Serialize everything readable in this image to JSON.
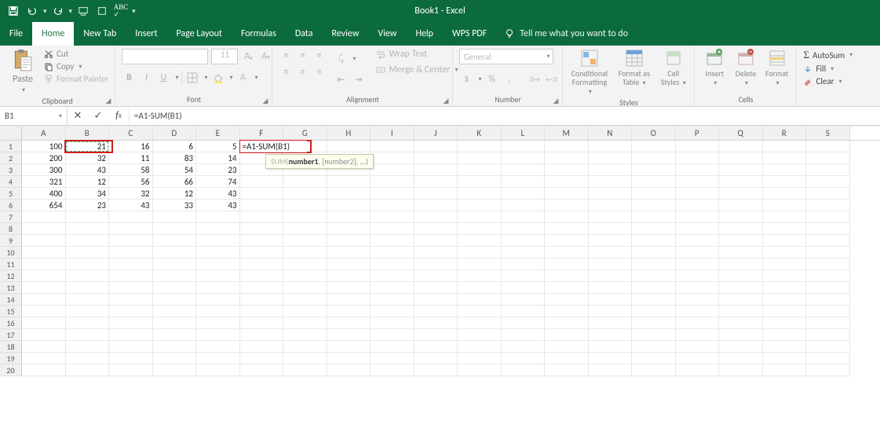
{
  "window": {
    "title": "Book1 - Excel"
  },
  "tabs": [
    "File",
    "Home",
    "New Tab",
    "Insert",
    "Page Layout",
    "Formulas",
    "Data",
    "Review",
    "View",
    "Help",
    "WPS PDF"
  ],
  "active_tab": "Home",
  "tell_me": "Tell me what you want to do",
  "ribbon": {
    "clipboard": {
      "paste": "Paste",
      "cut": "Cut",
      "copy": "Copy",
      "format_painter": "Format Painter",
      "label": "Clipboard"
    },
    "font": {
      "size": "11",
      "label": "Font"
    },
    "alignment": {
      "wrap": "Wrap Text",
      "merge": "Merge & Center",
      "label": "Alignment"
    },
    "number": {
      "format": "General",
      "label": "Number"
    },
    "styles": {
      "cond": "Conditional Formatting",
      "table": "Format as Table",
      "cell": "Cell Styles",
      "label": "Styles"
    },
    "cells": {
      "insert": "Insert",
      "delete": "Delete",
      "format": "Format",
      "label": "Cells"
    },
    "editing": {
      "autosum": "AutoSum",
      "fill": "Fill",
      "clear": "Clear"
    }
  },
  "name_box": "B1",
  "formula": "=A1-SUM(B1)",
  "active_cell_text": "=A1-SUM(B1)",
  "tooltip": {
    "fn": "SUM",
    "sig_bold": "number1",
    "sig_rest": ", [number2], ...)"
  },
  "columns": [
    "A",
    "B",
    "C",
    "D",
    "E",
    "F",
    "G",
    "H",
    "I",
    "J",
    "K",
    "L",
    "M",
    "N",
    "O",
    "P",
    "Q",
    "R",
    "S"
  ],
  "data_rows": [
    [
      "100",
      "21",
      "16",
      "6",
      "5"
    ],
    [
      "200",
      "32",
      "11",
      "83",
      "14"
    ],
    [
      "300",
      "43",
      "58",
      "54",
      "23"
    ],
    [
      "321",
      "12",
      "56",
      "66",
      "74"
    ],
    [
      "400",
      "34",
      "32",
      "12",
      "43"
    ],
    [
      "654",
      "23",
      "43",
      "33",
      "43"
    ]
  ],
  "blank_rows": 14,
  "chart_data": {
    "type": "table",
    "columns": [
      "A",
      "B",
      "C",
      "D",
      "E"
    ],
    "rows": [
      [
        100,
        21,
        16,
        6,
        5
      ],
      [
        200,
        32,
        11,
        83,
        14
      ],
      [
        300,
        43,
        58,
        54,
        23
      ],
      [
        321,
        12,
        56,
        66,
        74
      ],
      [
        400,
        34,
        32,
        12,
        43
      ],
      [
        654,
        23,
        43,
        33,
        43
      ]
    ]
  }
}
